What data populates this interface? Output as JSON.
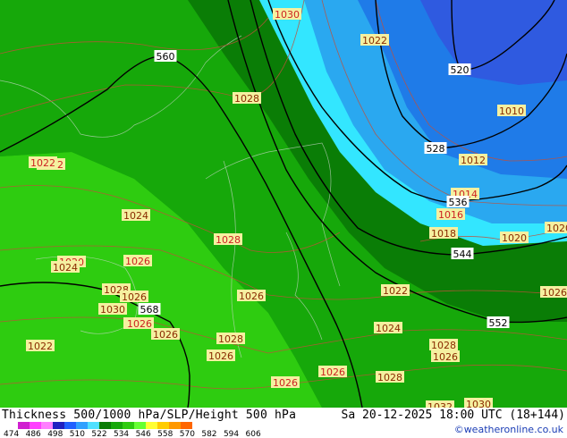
{
  "map": {
    "isobar_labels": [
      "1030",
      "1022",
      "1028",
      "1022",
      "1024",
      "1028",
      "1020",
      "1024",
      "1026",
      "1028",
      "1026",
      "1030",
      "1028",
      "1026",
      "1028",
      "1026",
      "1026",
      "1026",
      "1026",
      "1028",
      "1022",
      "1022",
      "1024",
      "1028",
      "1026",
      "1032",
      "1030",
      "1014",
      "1016",
      "1018",
      "1020",
      "1010",
      "1012",
      "1022",
      "1026",
      "1026",
      "1020"
    ],
    "thickness_labels": [
      "560",
      "520",
      "528",
      "536",
      "544",
      "552",
      "568"
    ],
    "colors": {
      "green_bright": "#2ecc10",
      "green_mid": "#16a80a",
      "green_dark": "#0a7d06",
      "cyan": "#33e6ff",
      "blue_light": "#2aa8f0",
      "blue_mid": "#1f7be8",
      "blue_deep": "#2f5ae0"
    }
  },
  "footer": {
    "title": "Thickness 500/1000 hPa/SLP/Height 500 hPa",
    "datetime": "Sa 20-12-2025 18:00 UTC (18+144)",
    "credit": "©weatheronline.co.uk",
    "scale_values": [
      "474",
      "486",
      "498",
      "510",
      "522",
      "534",
      "546",
      "558",
      "570",
      "582",
      "594",
      "606"
    ],
    "scale_colors": [
      "#d020d0",
      "#ff40ff",
      "#ff80ff",
      "#2020c0",
      "#2060ff",
      "#30a0ff",
      "#50e0ff",
      "#0a7d06",
      "#16a80a",
      "#2ecc10",
      "#66ff33",
      "#ffff33",
      "#ffcc00",
      "#ff9900",
      "#ff6600"
    ]
  }
}
